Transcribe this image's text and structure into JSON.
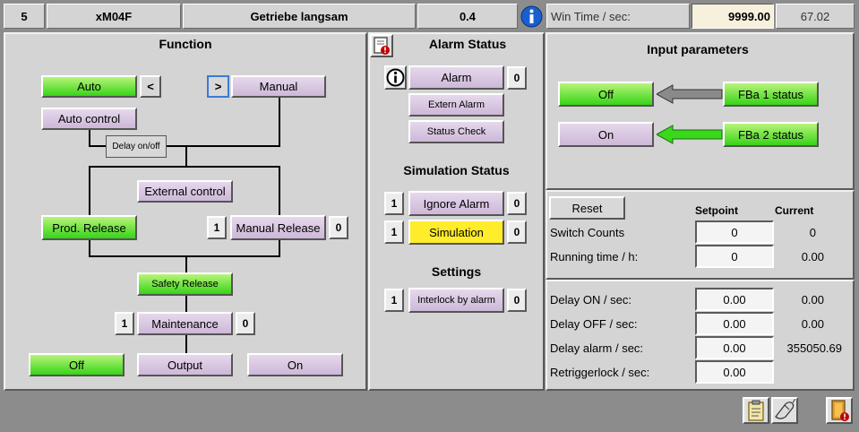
{
  "header": {
    "id": "5",
    "module": "xM04F",
    "description": "Getriebe langsam",
    "value": "0.4",
    "win_time_label": "Win Time  /  sec:",
    "win_time_setpoint": "9999.00",
    "win_time_current": "67.02"
  },
  "function": {
    "title": "Function",
    "auto": "Auto",
    "left_arrow": "<",
    "right_arrow": ">",
    "manual": "Manual",
    "auto_control": "Auto control",
    "delay_onoff": "Delay on/off",
    "external_control": "External control",
    "prod_release": "Prod. Release",
    "manual_release_left": "1",
    "manual_release": "Manual Release",
    "manual_release_right": "0",
    "safety_release": "Safety Release",
    "maintenance_left": "1",
    "maintenance": "Maintenance",
    "maintenance_right": "0",
    "off": "Off",
    "output": "Output",
    "on": "On"
  },
  "alarm_status": {
    "title": "Alarm Status",
    "alarm": "Alarm",
    "alarm_value": "0",
    "extern_alarm": "Extern Alarm",
    "status_check": "Status Check"
  },
  "simulation_status": {
    "title": "Simulation Status",
    "ignore_alarm_left": "1",
    "ignore_alarm": "Ignore Alarm",
    "ignore_alarm_right": "0",
    "simulation_left": "1",
    "simulation": "Simulation",
    "simulation_right": "0"
  },
  "settings": {
    "title": "Settings",
    "interlock_left": "1",
    "interlock": "Interlock by alarm",
    "interlock_right": "0"
  },
  "input_parameters": {
    "title": "Input parameters",
    "row1_state": "Off",
    "row1_label": "FBa 1 status",
    "row2_state": "On",
    "row2_label": "FBa 2 status"
  },
  "counters": {
    "reset": "Reset",
    "setpoint_header": "Setpoint",
    "current_header": "Current",
    "switch_counts_label": "Switch Counts",
    "switch_counts_setpoint": "0",
    "switch_counts_current": "0",
    "running_time_label": "Running time  /  h:",
    "running_time_setpoint": "0",
    "running_time_current": "0.00"
  },
  "delays": {
    "delay_on_label": "Delay ON  / sec:",
    "delay_on_setpoint": "0.00",
    "delay_on_current": "0.00",
    "delay_off_label": "Delay OFF  / sec:",
    "delay_off_setpoint": "0.00",
    "delay_off_current": "0.00",
    "delay_alarm_label": "Delay alarm  / sec:",
    "delay_alarm_setpoint": "0.00",
    "delay_alarm_current": "355050.69",
    "retriggerlock_label": "Retriggerlock / sec:",
    "retriggerlock_setpoint": "0.00"
  },
  "colors": {
    "panel": "#d4d4d4",
    "lilac": "#d9c8e2",
    "green": "#45d81e",
    "yellow": "#ffec2a",
    "info_blue": "#1a5fd0"
  },
  "icons": {
    "info": "info-icon",
    "alarm_book": "alarm-book-icon",
    "clipboard": "clipboard-icon",
    "mouse": "mouse-icon",
    "exit_door": "exit-door-icon"
  }
}
